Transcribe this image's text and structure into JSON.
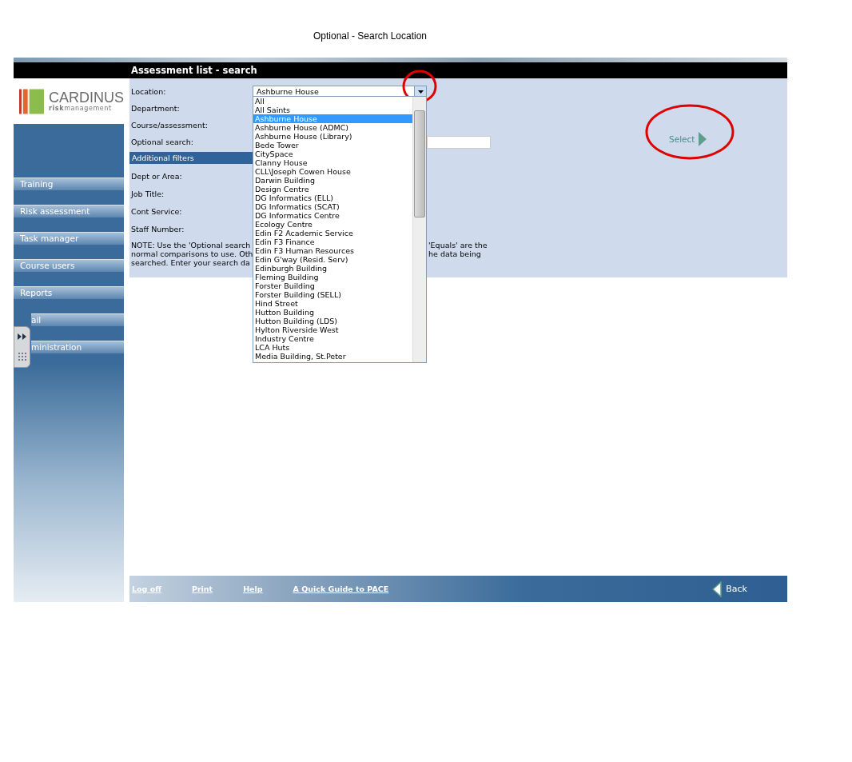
{
  "caption": "Optional - Search Location",
  "header": {
    "title": "Assessment list - search"
  },
  "logo": {
    "name": "CARDINUS",
    "tagline_bold": "risk",
    "tagline": "management"
  },
  "nav": [
    {
      "label": "Training",
      "covered": false
    },
    {
      "label": "Risk assessment",
      "covered": false
    },
    {
      "label": "Task manager",
      "covered": false
    },
    {
      "label": "Course users",
      "covered": false
    },
    {
      "label": "Reports",
      "covered": false
    },
    {
      "label": "ail",
      "covered": true
    },
    {
      "label": "ministration",
      "covered": true
    }
  ],
  "form": {
    "fields": [
      {
        "label": "Location:",
        "kind": "select"
      },
      {
        "label": "Department:",
        "kind": "blank"
      },
      {
        "label": "Course/assessment:",
        "kind": "blank"
      },
      {
        "label": "Optional search:",
        "kind": "input"
      }
    ],
    "section": "Additional filters",
    "filters": [
      {
        "label": "Dept or Area:"
      },
      {
        "label": "Job Title:"
      },
      {
        "label": "Cont Service:"
      },
      {
        "label": "Staff Number:"
      }
    ],
    "note_left": [
      "NOTE: Use the 'Optional search",
      "normal comparisons to use. Oth",
      "searched. Enter your search da"
    ],
    "note_right": [
      "'Equals' are the",
      "he data being"
    ]
  },
  "location": {
    "value": "Ashburne House",
    "options": [
      {
        "label": "All",
        "selected": false
      },
      {
        "label": "All Saints",
        "selected": false
      },
      {
        "label": "Ashburne House",
        "selected": true
      },
      {
        "label": "Ashburne House (ADMC)",
        "selected": false
      },
      {
        "label": "Ashburne House (Library)",
        "selected": false
      },
      {
        "label": "Bede Tower",
        "selected": false
      },
      {
        "label": "CitySpace",
        "selected": false
      },
      {
        "label": "Clanny House",
        "selected": false
      },
      {
        "label": "CLL\\Joseph Cowen House",
        "selected": false
      },
      {
        "label": "Darwin Building",
        "selected": false
      },
      {
        "label": "Design Centre",
        "selected": false
      },
      {
        "label": "DG Informatics (ELL)",
        "selected": false
      },
      {
        "label": "DG Informatics (SCAT)",
        "selected": false
      },
      {
        "label": "DG Informatics Centre",
        "selected": false
      },
      {
        "label": "Ecology Centre",
        "selected": false
      },
      {
        "label": "Edin F2 Academic Service",
        "selected": false
      },
      {
        "label": "Edin F3 Finance",
        "selected": false
      },
      {
        "label": "Edin F3 Human Resources",
        "selected": false
      },
      {
        "label": "Edin G'way (Resid. Serv)",
        "selected": false
      },
      {
        "label": "Edinburgh Building",
        "selected": false
      },
      {
        "label": "Fleming Building",
        "selected": false
      },
      {
        "label": "Forster Building",
        "selected": false
      },
      {
        "label": "Forster Building (SELL)",
        "selected": false
      },
      {
        "label": "Hind Street",
        "selected": false
      },
      {
        "label": "Hutton Building",
        "selected": false
      },
      {
        "label": "Hutton Building (LDS)",
        "selected": false
      },
      {
        "label": "Hylton Riverside West",
        "selected": false
      },
      {
        "label": "Industry Centre",
        "selected": false
      },
      {
        "label": "LCA Huts",
        "selected": false
      },
      {
        "label": "Media Building, St.Peter",
        "selected": false
      }
    ]
  },
  "select_button": "Select",
  "footer": {
    "links": [
      "Log off",
      "Print",
      "Help",
      "A Quick Guide to PACE"
    ],
    "back": "Back"
  }
}
